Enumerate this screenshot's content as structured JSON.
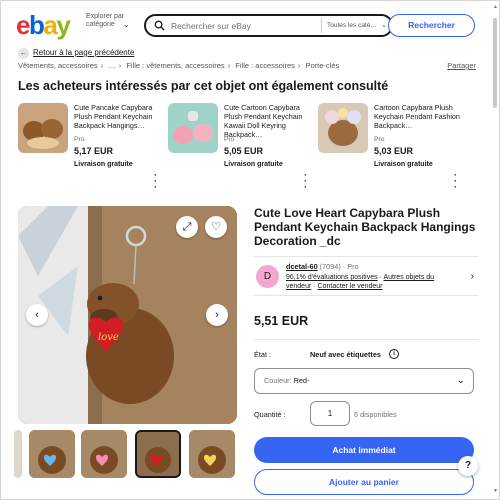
{
  "header": {
    "logo_letters": [
      "e",
      "b",
      "a",
      "y"
    ],
    "explore_label": "Explorer par catégorie",
    "search_placeholder": "Rechercher sur eBay",
    "category_select": "Toutes les caté…",
    "search_button": "Rechercher"
  },
  "breadcrumb": {
    "back_label": "Retour à la page précédente",
    "items": [
      "Vêtements, accessoires",
      "…",
      "Fille : vêtements, accessoires",
      "Fille : accessoires",
      "Porte-clés"
    ],
    "share_label": "Partager"
  },
  "also_viewed": {
    "title": "Les acheteurs intéressés par cet objet ont également consulté",
    "items": [
      {
        "title": "Cute Pancake Capybara Plush Pendant Keychain Backpack Hangings…",
        "condition": "Pro",
        "price": "5,17 EUR",
        "shipping": "Livraison gratuite"
      },
      {
        "title": "Cute Cartoon Capybara Plush Pendant Keychain Kawaii Doll Keyring Backpack…",
        "condition": "Pro",
        "price": "5,05 EUR",
        "shipping": "Livraison gratuite"
      },
      {
        "title": "Cartoon Capybara Plush Keychain Pendant Fashion Backpack…",
        "condition": "Pro",
        "price": "5,03 EUR",
        "shipping": "Livraison gratuite"
      }
    ]
  },
  "gallery": {
    "thumbnail_count": 5,
    "selected_thumbnail": 3
  },
  "product": {
    "title": "Cute Love Heart Capybara Plush Pendant Keychain Backpack Hangings Decoration _dc",
    "seller": {
      "avatar_letter": "D",
      "name": "dcetal-60",
      "feedback_count": "(7094)",
      "type": "· Pro",
      "positive": "96,1% d'évaluations positives",
      "other_items": "Autres objets du vendeur",
      "contact": "Contacter le vendeur"
    },
    "price": "5,51 EUR",
    "condition_label": "État :",
    "condition_value": "Neuf avec étiquettes",
    "color_label": "Couleur: ",
    "color_value": "Red-",
    "quantity_label": "Quantité :",
    "quantity_value": "1",
    "quantity_available": "6 disponibles",
    "buy_now": "Achat immédiat",
    "add_to_cart": "Ajouter au panier"
  },
  "icons": {
    "search": "search-icon",
    "expand": "expand-icon",
    "favorite": "heart-icon",
    "prev": "chevron-left-icon",
    "next": "chevron-right-icon",
    "info": "info-icon",
    "help": "help-icon"
  },
  "colors": {
    "accent": "#3665f3",
    "text": "#191919",
    "muted": "#707070"
  }
}
